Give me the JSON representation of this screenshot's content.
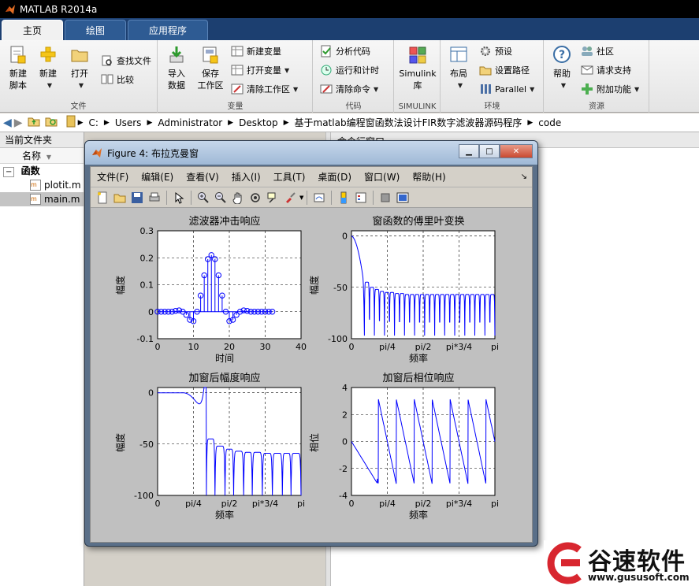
{
  "window": {
    "title": "MATLAB R2014a"
  },
  "tabs": [
    {
      "label": "主页",
      "active": true
    },
    {
      "label": "绘图",
      "active": false
    },
    {
      "label": "应用程序",
      "active": false
    }
  ],
  "ribbon": {
    "file": {
      "label": "文件",
      "new_script": "新建\n脚本",
      "new": "新建",
      "open": "打开",
      "find_files": "查找文件",
      "compare": "比较"
    },
    "variable": {
      "label": "变量",
      "import_data": "导入\n数据",
      "save_workspace": "保存\n工作区",
      "new_variable": "新建变量",
      "open_variable": "打开变量",
      "clear_workspace": "清除工作区"
    },
    "code": {
      "label": "代码",
      "analyze": "分析代码",
      "run_time": "运行和计时",
      "clear_commands": "清除命令"
    },
    "simulink": {
      "label": "SIMULINK",
      "library": "Simulink\n库"
    },
    "environment": {
      "label": "环境",
      "layout": "布局",
      "preferences": "预设",
      "set_path": "设置路径",
      "parallel": "Parallel"
    },
    "resources": {
      "label": "资源",
      "help": "帮助",
      "community": "社区",
      "support": "请求支持",
      "addons": "附加功能"
    }
  },
  "address": {
    "segments": [
      "C:",
      "Users",
      "Administrator",
      "Desktop",
      "基于matlab编程窗函数法设计FIR数字滤波器源码程序",
      "code"
    ]
  },
  "current_folder": {
    "title": "当前文件夹",
    "column_name": "名称",
    "group": "函数",
    "files": [
      "plotit.m",
      "main.m"
    ]
  },
  "command_window": {
    "title": "命令行窗口"
  },
  "figure": {
    "title": "Figure 4: 布拉克曼窗",
    "menus": [
      "文件(F)",
      "编辑(E)",
      "查看(V)",
      "插入(I)",
      "工具(T)",
      "桌面(D)",
      "窗口(W)",
      "帮助(H)"
    ]
  },
  "chart_data": [
    {
      "type": "scatter",
      "title": "滤波器冲击响应",
      "xlabel": "时间",
      "ylabel": "幅度",
      "xlim": [
        0,
        40
      ],
      "ylim": [
        -0.1,
        0.3
      ],
      "xticks": [
        "0",
        "10",
        "20",
        "30",
        "40"
      ],
      "yticks": [
        "-0.1",
        "0",
        "0.1",
        "0.2",
        "0.3"
      ],
      "grid": true,
      "x": [
        0,
        1,
        2,
        3,
        4,
        5,
        6,
        7,
        8,
        9,
        10,
        11,
        12,
        13,
        14,
        15,
        16,
        17,
        18,
        19,
        20,
        21,
        22,
        23,
        24,
        25,
        26,
        27,
        28,
        29,
        30,
        31,
        32
      ],
      "y": [
        0,
        0,
        0,
        0,
        0,
        0.003,
        0.005,
        0,
        -0.012,
        -0.03,
        -0.035,
        0,
        0.06,
        0.135,
        0.195,
        0.21,
        0.195,
        0.135,
        0.06,
        0,
        -0.035,
        -0.03,
        -0.012,
        0,
        0.005,
        0.003,
        0,
        0,
        0,
        0,
        0,
        0,
        0
      ]
    },
    {
      "type": "line",
      "title": "窗函数的傅里叶变换",
      "xlabel": "频率",
      "ylabel": "幅度",
      "xlim": [
        0,
        1
      ],
      "ylim": [
        -100,
        5
      ],
      "xticks": [
        "0",
        "pi/4",
        "pi/2",
        "pi*3/4",
        "pi"
      ],
      "yticks": [
        "0",
        "-50",
        "-100"
      ],
      "grid": true,
      "mainlobe_width": 0.09,
      "nulls": [
        0.09,
        0.125,
        0.16,
        0.195,
        0.23,
        0.265,
        0.3,
        0.335,
        0.37,
        0.405,
        0.44,
        0.475,
        0.51,
        0.545,
        0.58,
        0.615,
        0.65,
        0.685,
        0.72,
        0.755,
        0.79,
        0.825,
        0.86,
        0.895,
        0.93,
        0.965
      ],
      "null_depth": -97,
      "sidelobe_peaks": [
        -45,
        -50,
        -52,
        -54,
        -55,
        -55,
        -56,
        -56,
        -57,
        -57,
        -57,
        -57,
        -57,
        -57,
        -57,
        -57,
        -57,
        -57,
        -57,
        -57,
        -57,
        -57,
        -57,
        -57,
        -57,
        -57
      ]
    },
    {
      "type": "line",
      "title": "加窗后幅度响应",
      "xlabel": "频率",
      "ylabel": "幅度",
      "xlim": [
        0,
        1
      ],
      "ylim": [
        -100,
        5
      ],
      "xticks": [
        "0",
        "pi/4",
        "pi/2",
        "pi*3/4",
        "pi"
      ],
      "yticks": [
        "0",
        "-50",
        "-100"
      ],
      "grid": true,
      "passband_edge": 0.18,
      "nulls": [
        0.34,
        0.4,
        0.47,
        0.53,
        0.6,
        0.66,
        0.73,
        0.8,
        0.87,
        0.93
      ],
      "null_depth": -100,
      "sidelobe_peaks": [
        -30,
        -45,
        -52,
        -55,
        -57,
        -58,
        -58,
        -59,
        -59,
        -59
      ]
    },
    {
      "type": "line",
      "title": "加窗后相位响应",
      "xlabel": "频率",
      "ylabel": "相位",
      "xlim": [
        0,
        1
      ],
      "ylim": [
        -4,
        4
      ],
      "xticks": [
        "0",
        "pi/4",
        "pi/2",
        "pi*3/4",
        "pi"
      ],
      "yticks": [
        "-4",
        "-2",
        "0",
        "2",
        "4"
      ],
      "grid": true,
      "phase_start": 0,
      "slope_per_unit": -50.27
    }
  ],
  "watermark": {
    "brand": "谷速软件",
    "url": "www.gususoft.com"
  },
  "colors": {
    "plot_line": "#0000ff",
    "ribbon_tab_bar": "#1c3f70",
    "figure_bg": "#c0c0c0"
  }
}
